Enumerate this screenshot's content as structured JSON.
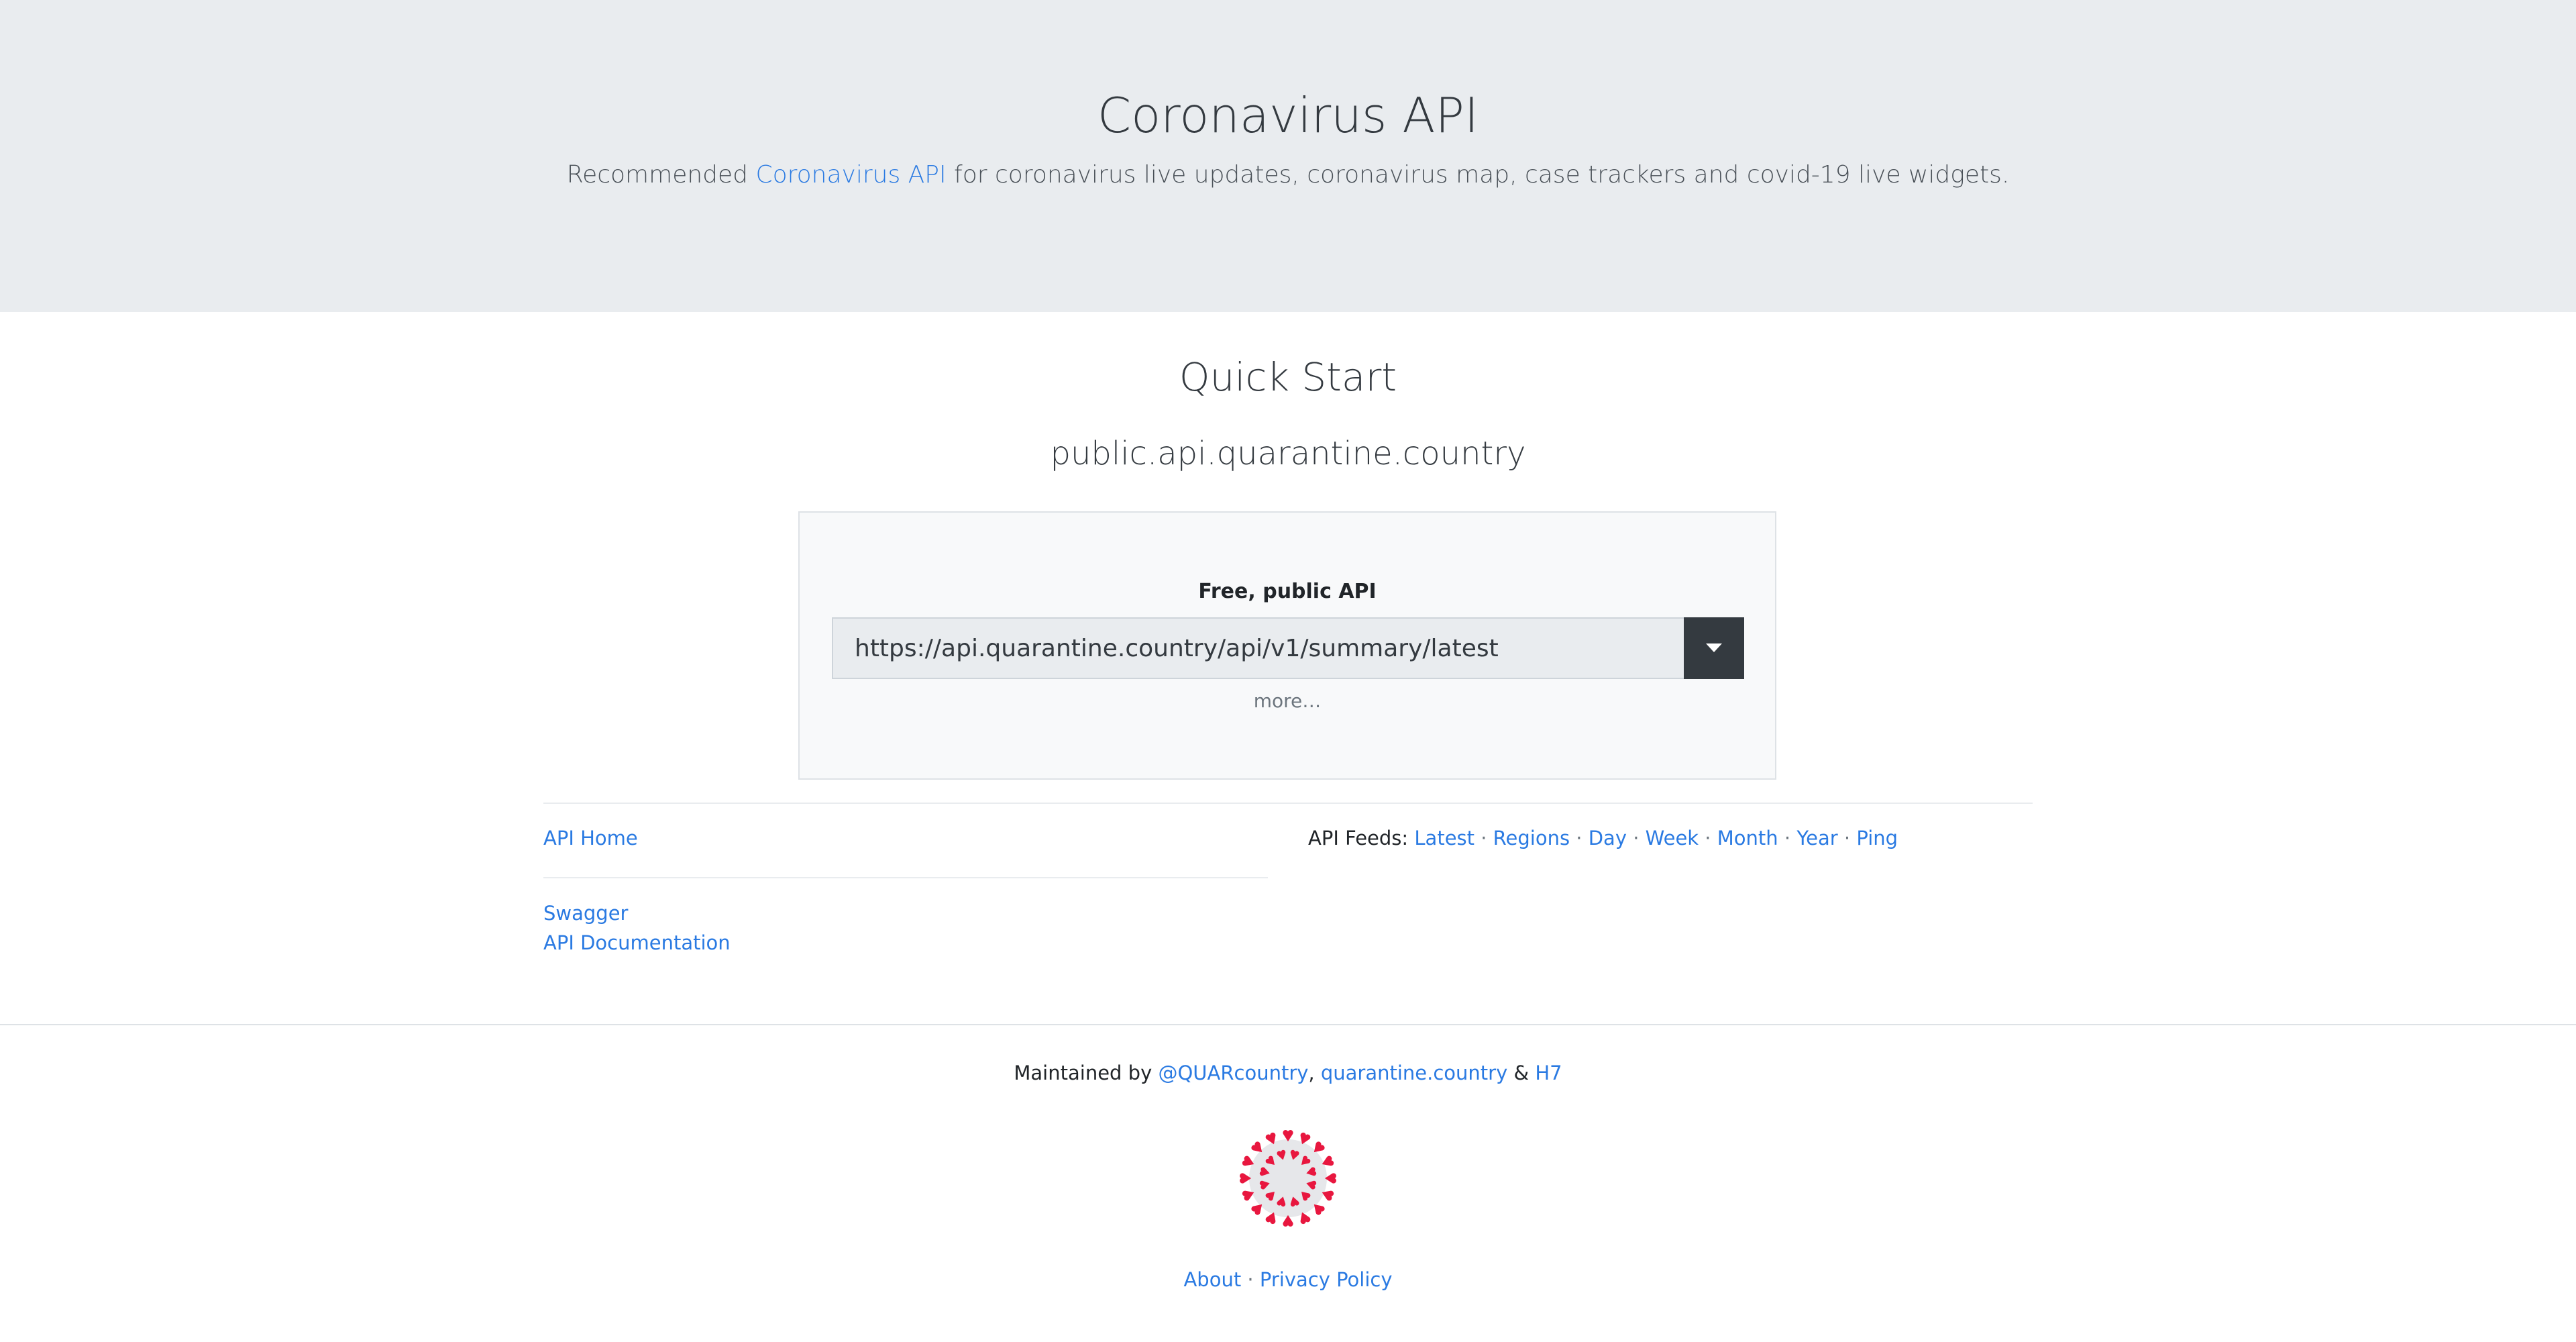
{
  "hero": {
    "title": "Coronavirus API",
    "subtitle_before": "Recommended ",
    "subtitle_link": "Coronavirus API",
    "subtitle_after": " for coronavirus live updates, coronavirus map, case trackers and covid-19 live widgets."
  },
  "quick_start": {
    "title": "Quick Start",
    "host": "public.api.quarantine.country",
    "card": {
      "label": "Free, public API",
      "url_value": "https://api.quarantine.country/api/v1/summary/latest",
      "more_label": "more…"
    }
  },
  "links": {
    "api_home": "API Home",
    "swagger": "Swagger",
    "api_documentation": "API Documentation"
  },
  "feeds": {
    "prefix": "API Feeds: ",
    "items": [
      "Latest",
      "Regions",
      "Day",
      "Week",
      "Month",
      "Year",
      "Ping"
    ],
    "separator": " · "
  },
  "footer": {
    "maintained_by": "Maintained by ",
    "link1": "@QUARcountry",
    "comma": ", ",
    "link2": "quarantine.country",
    "amp": " & ",
    "link3": "H7",
    "about": "About",
    "separator": " · ",
    "privacy": "Privacy Policy"
  },
  "colors": {
    "link": "#2a7ae2",
    "hero_bg": "#e9ecef",
    "virus_red": "#e8173f",
    "dark_button": "#343a40"
  },
  "icons": {
    "dropdown": "caret-down-icon",
    "logo": "coronavirus-logo-icon"
  }
}
